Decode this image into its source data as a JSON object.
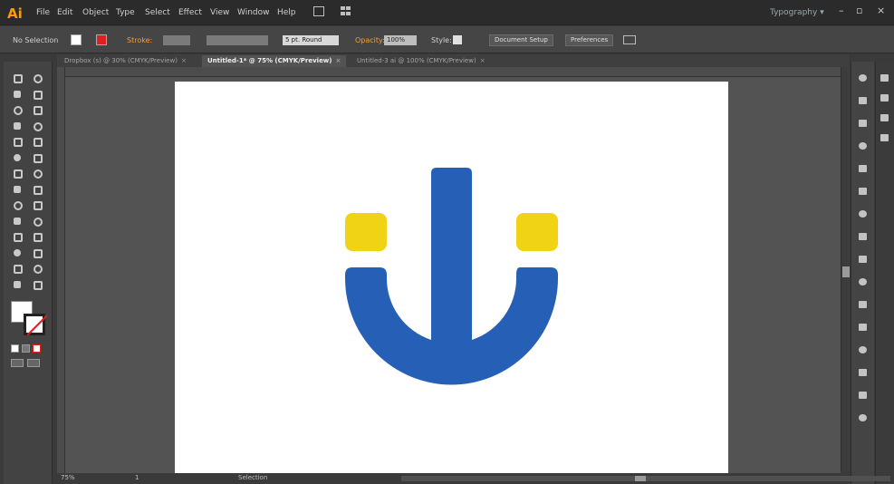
{
  "app": {
    "logo": "Ai"
  },
  "menu": {
    "items": [
      "File",
      "Edit",
      "Object",
      "Type",
      "Select",
      "Effect",
      "View",
      "Window",
      "Help"
    ]
  },
  "header": {
    "workspace": "Typography",
    "workspace_arrow": "▾"
  },
  "window_controls": {
    "minimize": "–",
    "maximize": "▫",
    "close": "×"
  },
  "controlbar": {
    "selection_label": "No Selection",
    "stroke_label": "Stroke:",
    "brush_label": "5 pt. Round",
    "opacity_label": "Opacity:",
    "opacity_value": "100%",
    "style_label": "Style:",
    "document_setup_label": "Document Setup",
    "preferences_label": "Preferences",
    "fill_color": "#ffffff",
    "stroke_color": "#e02020"
  },
  "tabs": [
    {
      "label": "Dropbox (s) @ 30% (CMYK/Preview)",
      "active": false
    },
    {
      "label": "Untitled-1* @ 75% (CMYK/Preview)",
      "active": true
    },
    {
      "label": "Untitled-3 ai @ 100% (CMYK/Preview)",
      "active": false
    }
  ],
  "tab_close_glyph": "×",
  "status": {
    "zoom": "75%",
    "artboard_number": "1",
    "tool_name": "Selection"
  },
  "logo_art": {
    "blue": "#2560b6",
    "yellow": "#f1d315"
  },
  "icons": {
    "tools": [
      "selection-tool-icon",
      "direct-selection-tool-icon",
      "magic-wand-tool-icon",
      "lasso-tool-icon",
      "pen-tool-icon",
      "type-tool-icon",
      "line-tool-icon",
      "rectangle-tool-icon",
      "paintbrush-tool-icon",
      "pencil-tool-icon",
      "blob-brush-tool-icon",
      "eraser-tool-icon",
      "rotate-tool-icon",
      "scale-tool-icon",
      "width-tool-icon",
      "free-transform-tool-icon",
      "shape-builder-tool-icon",
      "perspective-grid-tool-icon",
      "mesh-tool-icon",
      "gradient-tool-icon",
      "eyedropper-tool-icon",
      "blend-tool-icon",
      "symbol-sprayer-tool-icon",
      "column-graph-tool-icon",
      "artboard-tool-icon",
      "slice-tool-icon",
      "hand-tool-icon",
      "zoom-tool-icon"
    ],
    "panels": [
      "color-panel-icon",
      "swatches-panel-icon",
      "brushes-panel-icon",
      "symbols-panel-icon",
      "graphic-styles-panel-icon",
      "appearance-panel-icon",
      "layers-panel-icon",
      "artboards-panel-icon",
      "transparency-panel-icon",
      "gradient-panel-icon",
      "stroke-panel-icon",
      "align-panel-icon",
      "transform-panel-icon",
      "pathfinder-panel-icon",
      "links-panel-icon",
      "navigator-panel-icon"
    ],
    "panels_secondary": [
      "character-panel-icon",
      "paragraph-panel-icon",
      "opentype-panel-icon",
      "glyphs-panel-icon"
    ]
  }
}
